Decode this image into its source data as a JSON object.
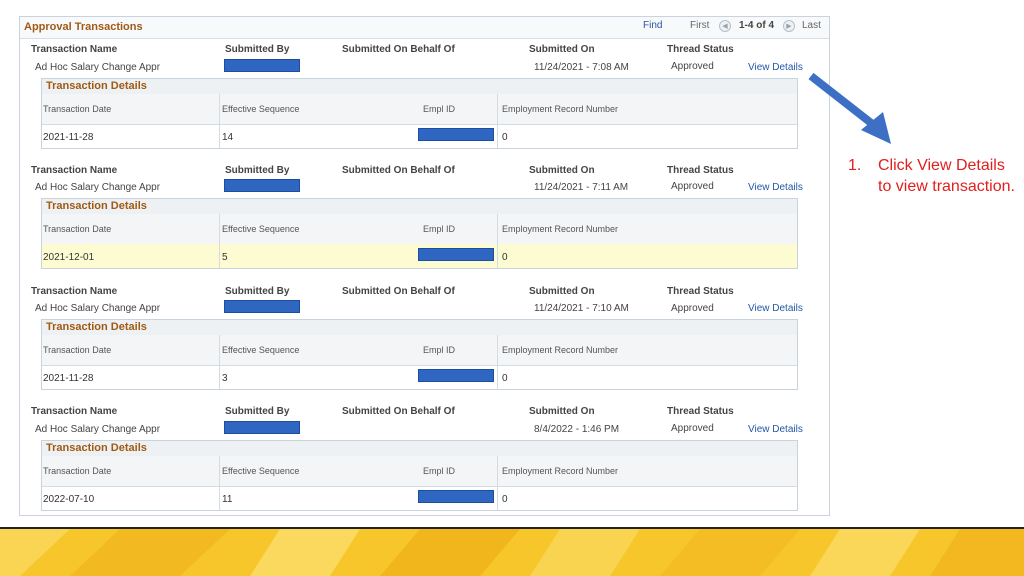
{
  "panel": {
    "title": "Approval Transactions",
    "find": "Find",
    "first": "First",
    "range": "1-4 of 4",
    "last": "Last"
  },
  "labels": {
    "transaction_name": "Transaction Name",
    "submitted_by": "Submitted By",
    "submitted_on_behalf_of": "Submitted On Behalf Of",
    "submitted_on": "Submitted On",
    "thread_status": "Thread Status",
    "view_details": "View Details",
    "details_title": "Transaction Details",
    "transaction_date": "Transaction Date",
    "effective_sequence": "Effective Sequence",
    "empl_id": "Empl ID",
    "employment_record_number": "Employment Record Number"
  },
  "transactions": [
    {
      "name": "Ad Hoc Salary Change Appr",
      "submitted_on": "11/24/2021 - 7:08 AM",
      "status": "Approved",
      "transaction_date": "2021-11-28",
      "effective_sequence": "14",
      "employment_record_number": "0"
    },
    {
      "name": "Ad Hoc Salary Change Appr",
      "submitted_on": "11/24/2021 - 7:11 AM",
      "status": "Approved",
      "transaction_date": "2021-12-01",
      "effective_sequence": "5",
      "employment_record_number": "0"
    },
    {
      "name": "Ad Hoc Salary Change Appr",
      "submitted_on": "11/24/2021 - 7:10 AM",
      "status": "Approved",
      "transaction_date": "2021-11-28",
      "effective_sequence": "3",
      "employment_record_number": "0"
    },
    {
      "name": "Ad Hoc Salary Change Appr",
      "submitted_on": "8/4/2022 - 1:46 PM",
      "status": "Approved",
      "transaction_date": "2022-07-10",
      "effective_sequence": "11",
      "employment_record_number": "0"
    }
  ],
  "instruction": {
    "number": "1.",
    "text": "Click View Details to view transaction."
  },
  "colors": {
    "accent": "#a05a13",
    "link": "#2457a6",
    "redaction": "#2e66c1",
    "arrow": "#3d6fc4",
    "instruction": "#e0201f",
    "footer": "#f6c62a",
    "highlight_row": "#fdfbd2"
  },
  "icons": {
    "prev": "prev-arrow-icon",
    "next": "next-arrow-icon",
    "pointer": "pointer-arrow-icon"
  }
}
